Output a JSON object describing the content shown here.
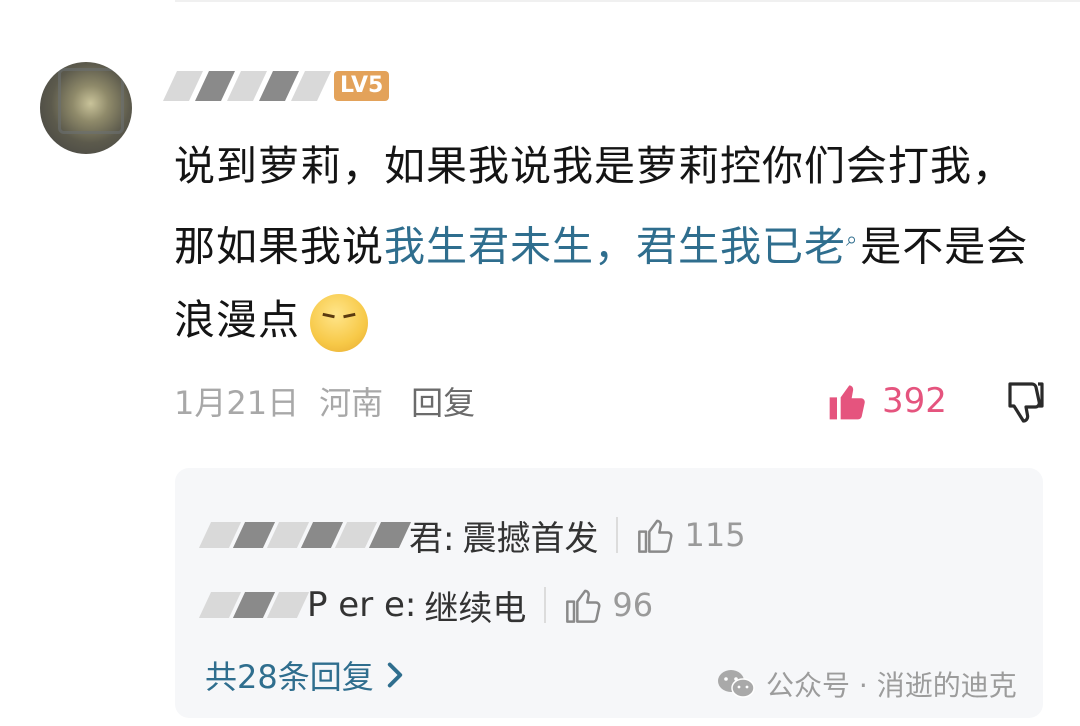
{
  "comment": {
    "username_visible": "▖▌▐",
    "level_badge": "LV5",
    "text_part1": "说到萝莉，如果我说我是萝莉控你们会打我，那如果我说",
    "highlight_text": "我生君未生，君生我已老",
    "text_part2": "是不是会浪漫点",
    "date": "1月21日",
    "location": "河南",
    "reply_label": "回复",
    "like_count": "392",
    "colors": {
      "highlight": "#2f6e8e",
      "like": "#e5547e",
      "level_badge": "#e3a25a"
    }
  },
  "replies": [
    {
      "author_visible": "君:",
      "text": "震撼首发",
      "like_count": "115"
    },
    {
      "author_visible": "P er e:",
      "text": "继续电",
      "like_count": "96"
    }
  ],
  "more_replies_label": "共28条回复",
  "watermark": "公众号 · 消逝的迪克",
  "icons": [
    "thumb-up-filled-icon",
    "thumb-down-icon",
    "thumb-up-outline-icon",
    "chevron-right-icon",
    "wechat-icon",
    "search-icon"
  ]
}
